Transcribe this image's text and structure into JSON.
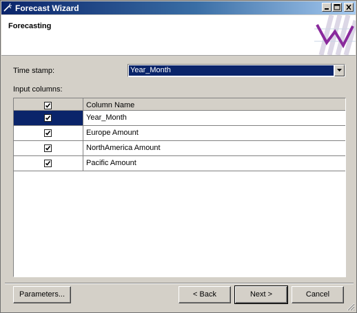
{
  "window": {
    "title": "Forecast Wizard"
  },
  "header": {
    "title": "Forecasting"
  },
  "timestamp": {
    "label": "Time stamp:",
    "value": "Year_Month"
  },
  "input_columns": {
    "label": "Input columns:",
    "header": "Column Name",
    "rows": [
      {
        "name": "Year_Month",
        "checked": true,
        "selected": true
      },
      {
        "name": "Europe Amount",
        "checked": true,
        "selected": false
      },
      {
        "name": "NorthAmerica Amount",
        "checked": true,
        "selected": false
      },
      {
        "name": "Pacific Amount",
        "checked": true,
        "selected": false
      }
    ]
  },
  "buttons": {
    "parameters": "Parameters...",
    "back": "< Back",
    "next": "Next >",
    "cancel": "Cancel"
  },
  "colors": {
    "selection": "#0a246a",
    "title_start": "#0a246a",
    "title_end": "#a6caf0",
    "face": "#d4d0c8"
  }
}
